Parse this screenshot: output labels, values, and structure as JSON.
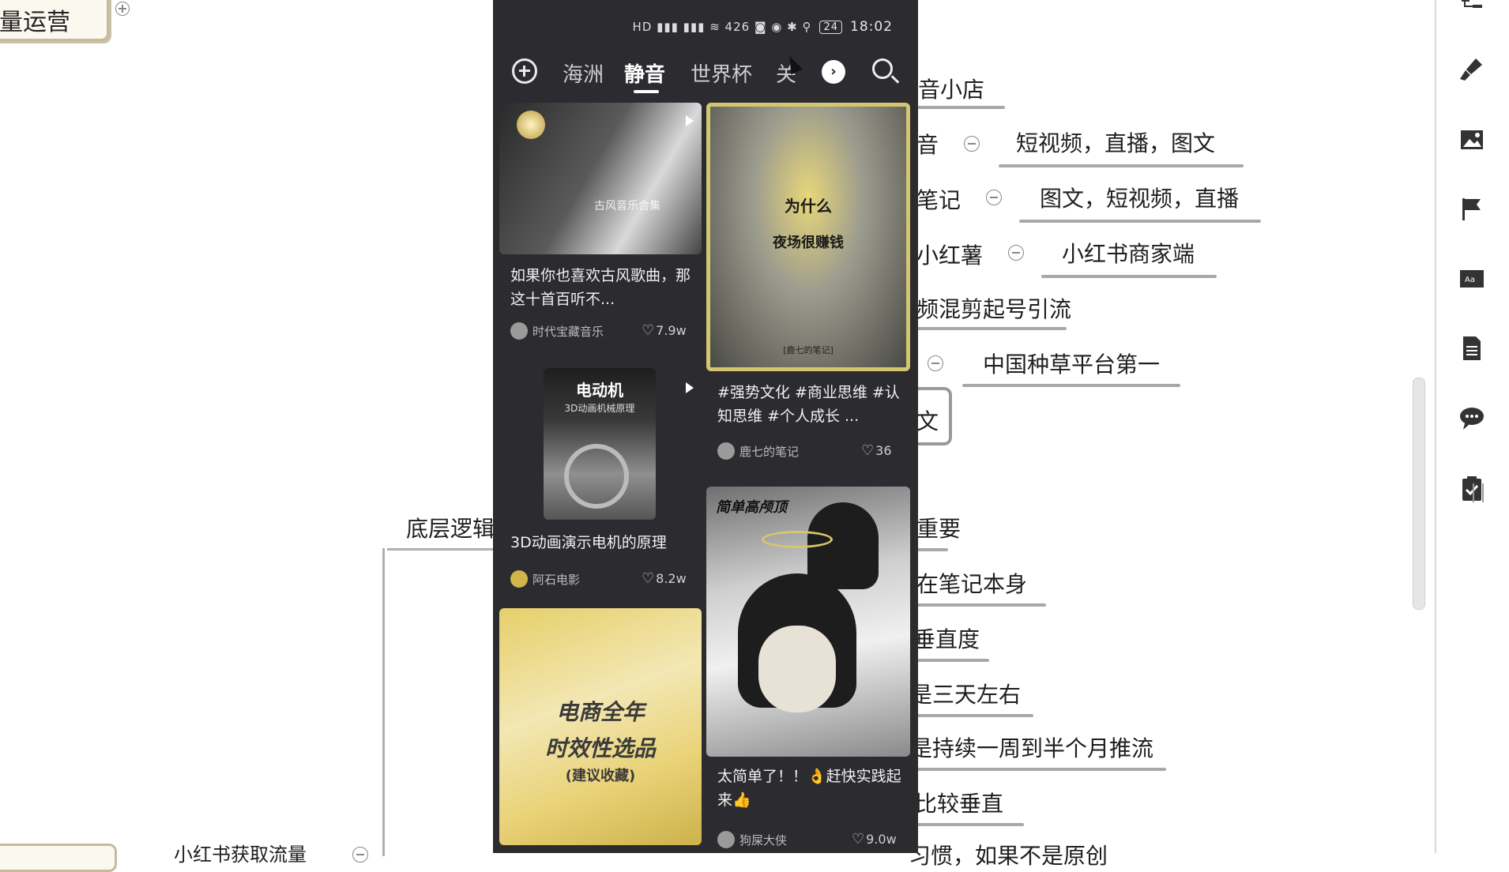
{
  "mindmap": {
    "root_label": "量运营",
    "branches": [
      {
        "label": "音小店"
      },
      {
        "label": "音",
        "child": "短视频，直播，图文"
      },
      {
        "label": "笔记",
        "child": "图文，短视频，直播"
      },
      {
        "label": "小红薯",
        "child": "小红书商家端"
      },
      {
        "label": "频混剪起号引流"
      },
      {
        "label": "",
        "child": "中国种草平台第一"
      },
      {
        "label": "文"
      }
    ],
    "left_branch": "底层逻辑",
    "sub_branches": [
      "重要",
      "在笔记本身",
      "垂直度",
      "是三天左右",
      "是持续一周到半个月推流",
      "比较垂直",
      "习惯，如果不是原创"
    ],
    "bottom_left": "小红书获取流量"
  },
  "toolbar": {
    "icons": [
      "structure-icon",
      "brush-icon",
      "image-icon",
      "flag-icon",
      "text-box-icon",
      "document-icon",
      "comment-icon",
      "clipboard-icon"
    ]
  },
  "phone": {
    "status": {
      "icons": "HD ▮▮▮ ▮▮▮ ≋ 426 ◙ ◉ ✱ ⚲",
      "battery": "24",
      "time": "18:02"
    },
    "tabs": [
      "海洲",
      "静音",
      "世界杯",
      "关"
    ],
    "active_tab": "静音",
    "cards": [
      {
        "thumb_text": "古风音乐合集",
        "title": "如果你也喜欢古风歌曲，那这十首百听不...",
        "author": "时代宝藏音乐",
        "likes": "7.9w"
      },
      {
        "thumb_line1": "为什么",
        "thumb_line2": "夜场很赚钱",
        "thumb_footer": "[鹿七的笔记]",
        "title": "#强势文化 #商业思维 #认知思维 #个人成长 ...",
        "author": "鹿七的笔记",
        "likes": "36"
      },
      {
        "thumb_line1": "电动机",
        "thumb_line2": "3D动画机械原理",
        "title": "3D动画演示电机的原理",
        "author": "阿石电影",
        "likes": "8.2w"
      },
      {
        "thumb_tag": "简单高颅顶",
        "title": "太简单了！！👌赶快实践起来👍",
        "author": "狗屎大侠",
        "likes": "9.0w"
      },
      {
        "thumb_line1": "电商全年",
        "thumb_line2": "时效性选品",
        "thumb_line3": "(建议收藏)"
      }
    ]
  }
}
